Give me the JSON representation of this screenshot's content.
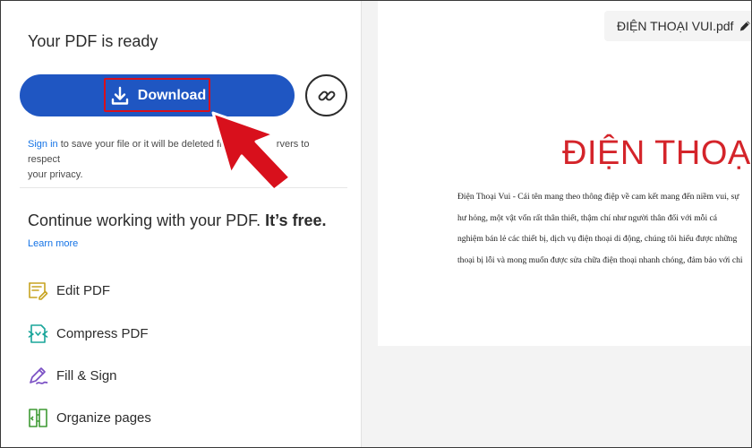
{
  "left_panel": {
    "title": "Your PDF is ready",
    "download_label": "Download",
    "signin_link": "Sign in",
    "signin_text_a": " to save your file or it will be deleted fro",
    "signin_text_b": "rvers to respect",
    "signin_text_c": "your privacy.",
    "continue_text": "Continue working with your PDF. ",
    "continue_free": "It’s free.",
    "learn_more": "Learn more",
    "tools": [
      {
        "label": "Edit PDF",
        "icon": "edit-pdf-icon"
      },
      {
        "label": "Compress PDF",
        "icon": "compress-pdf-icon"
      },
      {
        "label": "Fill & Sign",
        "icon": "fill-sign-icon"
      },
      {
        "label": "Organize pages",
        "icon": "organize-pages-icon"
      }
    ]
  },
  "document": {
    "filename": "ĐIỆN THOẠI VUI.pdf",
    "heading": "ĐIỆN THOẠI",
    "body_lines": [
      "Điện Thoại Vui - Cái tên mang theo thông điệp về cam kết mang đến niềm vui, sự",
      "hư hỏng, một vật vốn rất thân thiết, thậm chí như người thân đối với mỗi cá",
      "nghiệm bán lẻ các thiết bị, dịch vụ điện thoại di động, chúng tôi hiểu được những",
      "thoại bị lỗi và mong muốn được sửa chữa điện thoại nhanh chóng, đảm bảo với chi"
    ]
  },
  "colors": {
    "primary_button": "#1f56c2",
    "link": "#1473e6",
    "highlight_red": "#d8101c",
    "heading_red": "#d4242a"
  }
}
